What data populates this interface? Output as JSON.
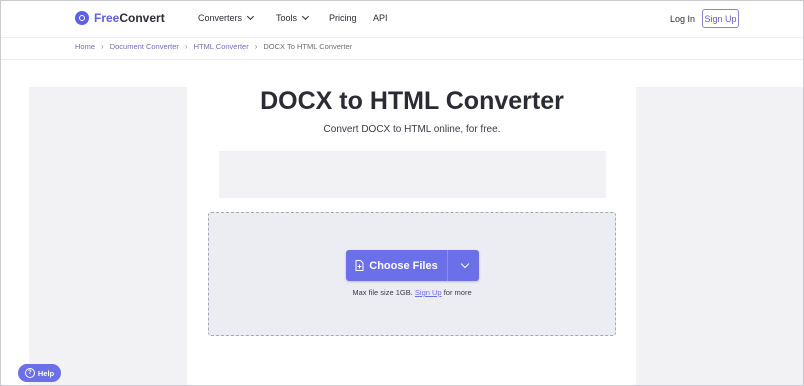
{
  "header": {
    "logo_free": "Free",
    "logo_convert": "Convert",
    "nav": [
      {
        "label": "Converters",
        "dropdown": true
      },
      {
        "label": "Tools",
        "dropdown": true
      },
      {
        "label": "Pricing",
        "dropdown": false
      },
      {
        "label": "API",
        "dropdown": false
      }
    ],
    "login_label": "Log In",
    "signup_label": "Sign Up"
  },
  "breadcrumb": [
    "Home",
    "Document Converter",
    "HTML Converter",
    "DOCX To HTML Converter"
  ],
  "main": {
    "title": "DOCX to HTML Converter",
    "subtitle": "Convert DOCX to HTML online, for free.",
    "choose_files_label": "Choose Files",
    "max_size_prefix": "Max file size 1GB.",
    "max_size_link": "Sign Up",
    "max_size_suffix": "for more"
  },
  "help_label": "Help",
  "colors": {
    "accent": "#6b6fe8",
    "brand": "#5b61e0",
    "link": "#6f6fb8"
  }
}
